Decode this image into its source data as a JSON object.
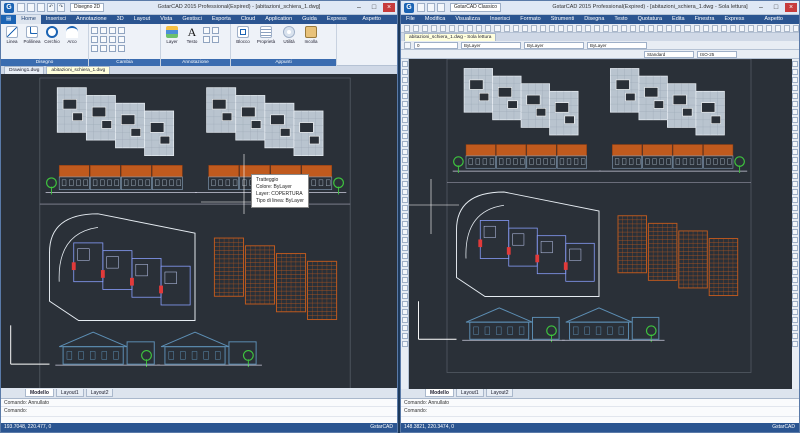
{
  "left": {
    "title": "GstarCAD 2015 Professional(Expired) - [abitazioni_schiera_1.dwg]",
    "workspace": "Disegno 2D",
    "ribbon_tabs": [
      "Home",
      "Inserisci",
      "Annotazione",
      "3D",
      "Layout",
      "Vista",
      "Gestisci",
      "Esporta",
      "Cloud",
      "Application",
      "Guida",
      "Express"
    ],
    "aspetto": "Aspetto",
    "groups": {
      "disegno": "Disegno",
      "cambia": "Cambia",
      "annotazione": "Annotazione",
      "appunti": "Appunti"
    },
    "buttons": {
      "linea": "Linea",
      "polilinea": "Polilinea",
      "cerchio": "Cerchio",
      "arco": "Arco",
      "layer": "Layer",
      "testo": "Testo",
      "blocco": "Blocco",
      "proprieta": "Proprietà",
      "utilita": "Utilità",
      "incolla": "Incolla"
    },
    "doc_tabs": [
      "Drawing1.dwg",
      "abitazioni_schiera_1.dwg"
    ],
    "tooltip": {
      "title": "Tratteggio",
      "colore": "Colore: ByLayer",
      "layer": "Layer: COPERTURA",
      "tipo": "Tipo di linea: ByLayer"
    },
    "layout_tabs": [
      "Modello",
      "Layout1",
      "Layout2"
    ],
    "cmd_prev": "Comando: Annullato",
    "cmd_prompt": "Comando:",
    "coords": "193.7048, 220.477, 0",
    "status_right": "GstarCAD"
  },
  "right": {
    "title": "GstarCAD 2015 Professional(Expired) - [abitazioni_schiera_1.dwg - Sola lettura]",
    "workspace": "GstarCAD Classico",
    "menu": [
      "File",
      "Modifica",
      "Visualizza",
      "Inserisci",
      "Formato",
      "Strumenti",
      "Disegna",
      "Testo",
      "Quotatura",
      "Edita",
      "Finestra",
      "Express"
    ],
    "aspetto": "Aspetto",
    "doc_tab": "abitazioni_schiera_1.dwg - Sola lettura",
    "layer_value": "0",
    "bylayer1": "ByLayer",
    "bylayer2": "ByLayer",
    "bylayer3": "ByLayer",
    "style": "Standard",
    "iso": "ISO-25",
    "layout_tabs": [
      "Modello",
      "Layout1",
      "Layout2"
    ],
    "cmd_prev": "Comando: Annullato",
    "cmd_prompt": "Comando:",
    "coords": "148.3821, 220.3474, 0",
    "status_right": "GstarCAD"
  },
  "colors": {
    "canvas": "#2a3038",
    "roof": "#c05a1e",
    "plan": "#b9c4cf",
    "wall": "#e6ecf2",
    "elev": "#5d8fb5",
    "tree": "#3ec23e",
    "red": "#e23a3a"
  }
}
